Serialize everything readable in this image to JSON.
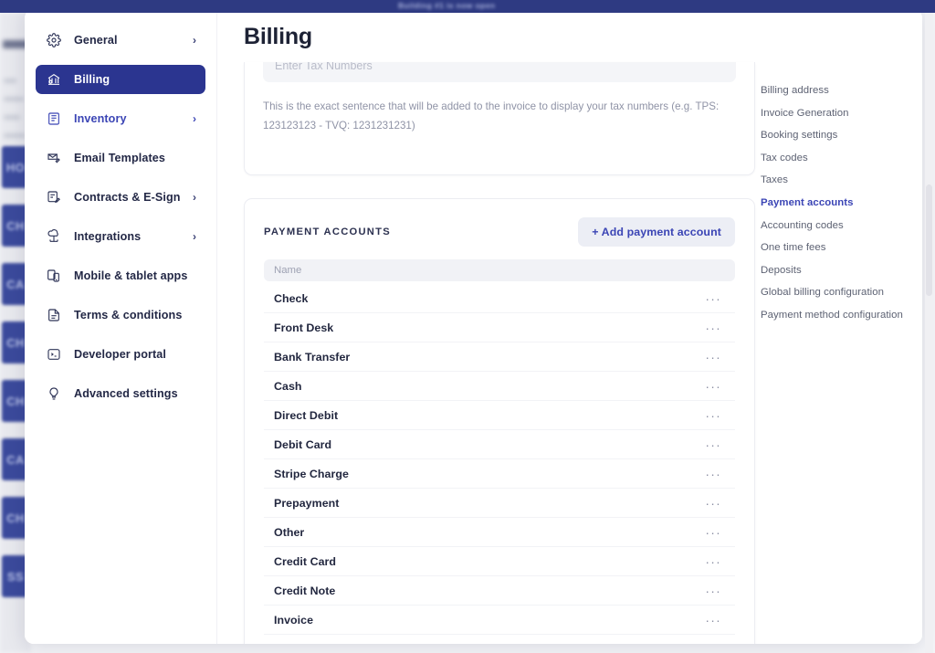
{
  "top_strip": {
    "toast_text": "Building #1 is now open"
  },
  "nav": {
    "items": [
      {
        "label": "General",
        "icon": "gear-icon",
        "chevron": "›",
        "state": "default"
      },
      {
        "label": "Billing",
        "icon": "bank-icon",
        "chevron": "",
        "state": "active"
      },
      {
        "label": "Inventory",
        "icon": "inventory-icon",
        "chevron": "›",
        "state": "accent"
      },
      {
        "label": "Email Templates",
        "icon": "envelope-edit-icon",
        "chevron": "",
        "state": "default"
      },
      {
        "label": "Contracts & E-Sign",
        "icon": "document-edit-icon",
        "chevron": "›",
        "state": "default"
      },
      {
        "label": "Integrations",
        "icon": "cloud-link-icon",
        "chevron": "›",
        "state": "default"
      },
      {
        "label": "Mobile & tablet apps",
        "icon": "devices-icon",
        "chevron": "",
        "state": "default"
      },
      {
        "label": "Terms & conditions",
        "icon": "document-icon",
        "chevron": "",
        "state": "default"
      },
      {
        "label": "Developer portal",
        "icon": "terminal-icon",
        "chevron": "",
        "state": "default"
      },
      {
        "label": "Advanced settings",
        "icon": "lightbulb-icon",
        "chevron": "",
        "state": "default"
      }
    ]
  },
  "page": {
    "title": "Billing"
  },
  "tax_card": {
    "input_value": "",
    "input_placeholder": "Enter Tax Numbers",
    "help_text": "This is the exact sentence that will be added to the invoice to display your tax numbers (e.g. TPS: 123123123 - TVQ: 1231231231)"
  },
  "payment_accounts": {
    "section_title": "PAYMENT ACCOUNTS",
    "add_button_label": "+ Add payment account",
    "column_header": "Name",
    "row_menu_glyph": "···",
    "rows": [
      {
        "name": "Check"
      },
      {
        "name": "Front Desk"
      },
      {
        "name": "Bank Transfer"
      },
      {
        "name": "Cash"
      },
      {
        "name": "Direct Debit"
      },
      {
        "name": "Debit Card"
      },
      {
        "name": "Stripe Charge"
      },
      {
        "name": "Prepayment"
      },
      {
        "name": "Other"
      },
      {
        "name": "Credit Card"
      },
      {
        "name": "Credit Note"
      },
      {
        "name": "Invoice"
      }
    ]
  },
  "anchors": {
    "items": [
      {
        "label": "Billing address",
        "current": false
      },
      {
        "label": "Invoice Generation",
        "current": false
      },
      {
        "label": "Booking settings",
        "current": false
      },
      {
        "label": "Tax codes",
        "current": false
      },
      {
        "label": "Taxes",
        "current": false
      },
      {
        "label": "Payment accounts",
        "current": true
      },
      {
        "label": "Accounting codes",
        "current": false
      },
      {
        "label": "One time fees",
        "current": false
      },
      {
        "label": "Deposits",
        "current": false
      },
      {
        "label": "Global billing configuration",
        "current": false
      },
      {
        "label": "Payment method configuration",
        "current": false
      }
    ]
  },
  "backdrop": {
    "chips": [
      "HO",
      "CH",
      "CA",
      "CH",
      "CH",
      "CA",
      "CH",
      "SS"
    ]
  },
  "colors": {
    "brand_navy": "#2b3590",
    "accent_indigo": "#3b45b5",
    "text_dark": "#22273f",
    "muted": "#8f93a6"
  }
}
